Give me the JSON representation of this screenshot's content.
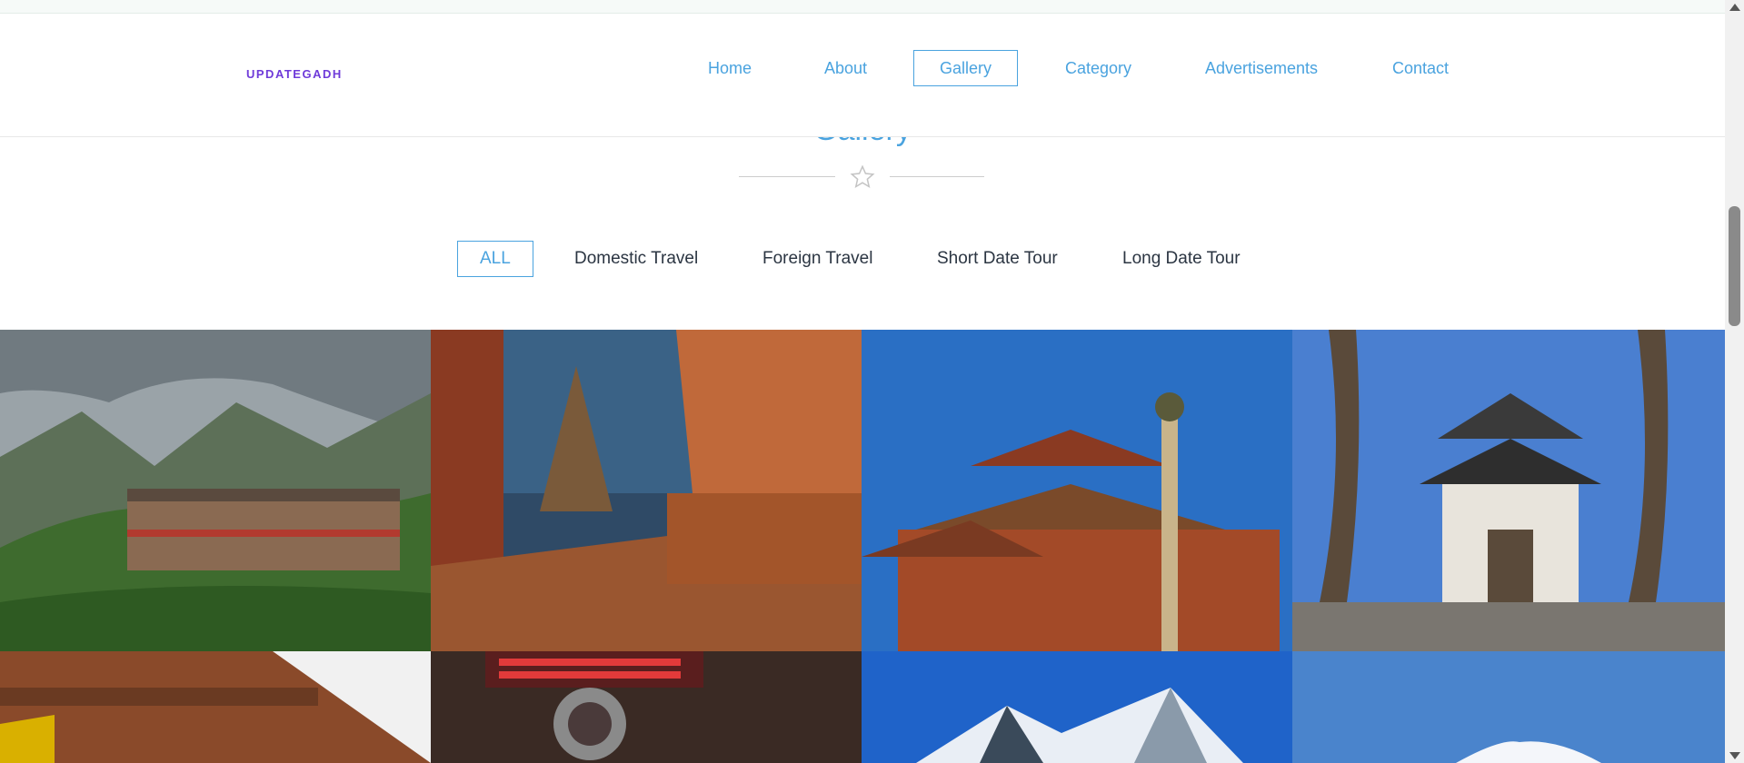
{
  "header": {
    "logo": "UPDATEGADH",
    "nav": [
      "Home",
      "About",
      "Gallery",
      "Category",
      "Advertisements",
      "Contact"
    ],
    "active_nav": "Gallery"
  },
  "section": {
    "title": "Gallery",
    "divider_icon": "star-icon"
  },
  "filters": {
    "items": [
      "ALL",
      "Domestic Travel",
      "Foreign Travel",
      "Short Date Tour",
      "Long Date Tour"
    ],
    "active": "ALL"
  },
  "gallery": {
    "images": [
      "mountain-village-photo",
      "stupa-prayer-wheels-photo",
      "pagoda-temples-photo",
      "pagoda-temple-tree-photo",
      "carved-wooden-temple-photo",
      "temple-sign-shrine-photo",
      "snow-peaks-photo",
      "snow-summit-photo"
    ]
  },
  "colors": {
    "accent": "#4aa3df",
    "logo": "#6f3bd9",
    "filter_text": "#2b3542"
  }
}
